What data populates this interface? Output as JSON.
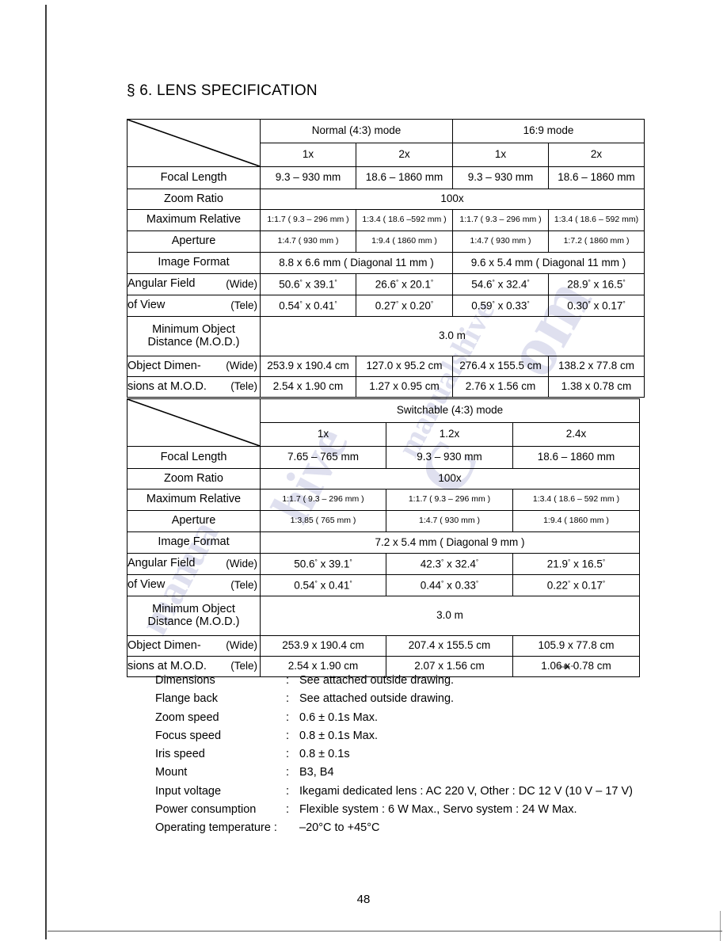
{
  "document": {
    "title": "§ 6. LENS SPECIFICATION",
    "page_number": "48"
  },
  "table1": {
    "mode_headers": [
      {
        "label": "Normal (4:3) mode",
        "span": 2
      },
      {
        "label": "16:9 mode",
        "span": 2
      }
    ],
    "magnifications": [
      "1x",
      "2x",
      "1x",
      "2x"
    ],
    "rows": [
      {
        "label": "Focal Length",
        "type": "cells",
        "values": [
          "9.3 – 930 mm",
          "18.6 – 1860 mm",
          "9.3 – 930 mm",
          "18.6 – 1860 mm"
        ]
      },
      {
        "label": "Zoom Ratio",
        "type": "span-all",
        "value": "100x"
      },
      {
        "label_line1": "Maximum Relative",
        "label_line2": "Aperture",
        "type": "two-line-small",
        "values_wide": [
          "1:1.7 ( 9.3 – 296 mm )",
          "1:3.4 ( 18.6 –592 mm )",
          "1:1.7 ( 9.3 – 296 mm )",
          "1:3.4 ( 18.6 – 592 mm)"
        ],
        "values_tele": [
          "1:4.7 ( 930 mm )",
          "1:9.4 ( 1860 mm )",
          "1:4.7 ( 930 mm )",
          "1:7.2 ( 1860 mm )"
        ]
      },
      {
        "label": "Image Format",
        "type": "span-pairs",
        "values": [
          "8.8 x 6.6 mm ( Diagonal 11 mm )",
          "9.6 x 5.4 mm ( Diagonal 11 mm )"
        ]
      },
      {
        "label_line1": "Angular Field",
        "label_line2": "of View",
        "sub1": "(Wide)",
        "sub2": "(Tele)",
        "type": "two-line",
        "values_wide": [
          "50.6° x 39.1°",
          "26.6° x 20.1°",
          "54.6° x 32.4°",
          "28.9° x 16.5°"
        ],
        "values_tele": [
          "0.54° x 0.41°",
          "0.27° x 0.20°",
          "0.59° x 0.33°",
          "0.30° x 0.17°"
        ]
      },
      {
        "label_line1": "Minimum Object",
        "label_line2": "Distance (M.O.D.)",
        "type": "span-all-twoline",
        "value": "3.0 m"
      },
      {
        "label_line1": "Object Dimen-",
        "label_line2": "sions at M.O.D.",
        "sub1": "(Wide)",
        "sub2": "(Tele)",
        "type": "two-line",
        "values_wide": [
          "253.9 x 190.4 cm",
          "127.0 x 95.2 cm",
          "276.4 x 155.5 cm",
          "138.2 x 77.8 cm"
        ],
        "values_tele": [
          "2.54 x 1.90 cm",
          "1.27 x 0.95 cm",
          "2.76 x 1.56 cm",
          "1.38 x 0.78 cm"
        ]
      }
    ]
  },
  "table2": {
    "mode_headers": [
      {
        "label": "Switchable (4:3) mode",
        "span": 3
      }
    ],
    "magnifications": [
      "1x",
      "1.2x",
      "2.4x"
    ],
    "rows": [
      {
        "label": "Focal Length",
        "type": "cells",
        "values": [
          "7.65 – 765 mm",
          "9.3 – 930 mm",
          "18.6 – 1860 mm"
        ]
      },
      {
        "label": "Zoom Ratio",
        "type": "span-all",
        "value": "100x"
      },
      {
        "label_line1": "Maximum Relative",
        "label_line2": "Aperture",
        "type": "two-line-small",
        "values_wide": [
          "1:1.7 ( 9.3 – 296 mm )",
          "1:1.7 ( 9.3 – 296 mm )",
          "1:3.4 ( 18.6 – 592 mm )"
        ],
        "values_tele": [
          "1:3.85 ( 765 mm )",
          "1:4.7 ( 930 mm )",
          "1:9.4 ( 1860 mm )"
        ]
      },
      {
        "label": "Image Format",
        "type": "span-all",
        "value": "7.2 x 5.4 mm ( Diagonal 9 mm )"
      },
      {
        "label_line1": "Angular Field",
        "label_line2": "of View",
        "sub1": "(Wide)",
        "sub2": "(Tele)",
        "type": "two-line",
        "values_wide": [
          "50.6° x 39.1°",
          "42.3° x 32.4°",
          "21.9° x 16.5°"
        ],
        "values_tele": [
          "0.54° x 0.41°",
          "0.44° x 0.33°",
          "0.22° x 0.17°"
        ]
      },
      {
        "label_line1": "Minimum Object",
        "label_line2": "Distance (M.O.D.)",
        "type": "span-all-twoline",
        "value": "3.0 m"
      },
      {
        "label_line1": "Object Dimen-",
        "label_line2": "sions at M.O.D.",
        "sub1": "(Wide)",
        "sub2": "(Tele)",
        "type": "two-line",
        "values_wide": [
          "253.9 x 190.4 cm",
          "207.4 x 155.5 cm",
          "105.9 x 77.8 cm"
        ],
        "values_tele": [
          "2.54 x 1.90 cm",
          "2.07 x 1.56 cm",
          "1.06 x 0.78 cm"
        ]
      }
    ]
  },
  "spec_list": [
    {
      "key": "Dimensions",
      "colon": ":",
      "value": "See attached outside drawing."
    },
    {
      "key": "Flange back",
      "colon": ":",
      "value": "See attached outside drawing."
    },
    {
      "key": "Zoom speed",
      "colon": ":",
      "value": "0.6 ± 0.1s Max."
    },
    {
      "key": "Focus speed",
      "colon": ":",
      "value": "0.8 ± 0.1s Max."
    },
    {
      "key": "Iris speed",
      "colon": ":",
      "value": "0.8 ± 0.1s"
    },
    {
      "key": "Mount",
      "colon": ":",
      "value": "B3, B4"
    },
    {
      "key": "Input voltage",
      "colon": ":",
      "value": "Ikegami dedicated lens : AC 220 V, Other : DC 12 V (10 V – 17 V)"
    },
    {
      "key": "Power consumption",
      "colon": ":",
      "value": "Flexible system : 6 W Max., Servo system : 24 W Max."
    },
    {
      "key": "Operating temperature :",
      "colon": "",
      "value": "–20°C to +45°C"
    }
  ],
  "watermark": {
    "fragments": [
      "m",
      "C",
      "o",
      "m",
      "a",
      "n",
      "u",
      "a",
      "l",
      "s",
      "h",
      "i",
      "v",
      "e"
    ]
  }
}
